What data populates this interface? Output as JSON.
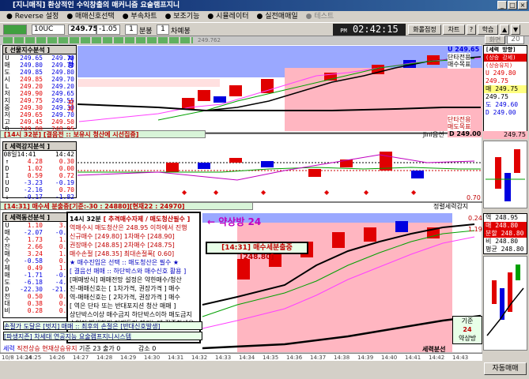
{
  "window": {
    "title": "[지니매직] 환상적인 수익창출의 매커니즘 요술램프지니"
  },
  "menu": [
    {
      "label": "Reverse 설정",
      "enabled": true
    },
    {
      "label": "매매신호선택",
      "enabled": true
    },
    {
      "label": "부속차트",
      "enabled": true
    },
    {
      "label": "보조기능",
      "enabled": true
    },
    {
      "label": "시뮬레이터",
      "enabled": true
    },
    {
      "label": "실전매매일",
      "enabled": true
    },
    {
      "label": "테스트",
      "enabled": false
    }
  ],
  "toolbar": {
    "code": "10UC",
    "price": "249.75",
    "change": "-1.05",
    "period_num": "1",
    "period_unit": "분봉",
    "count_num": "1",
    "count_unit": "차예봉",
    "clock_prefix": "PM",
    "clock": "02:42:15",
    "btn_rotate": "화롤점정",
    "btn_chart": "차트",
    "btn_study": "학습",
    "btn_screen": "화면",
    "screen_num": "20"
  },
  "subbar": {
    "value": "249.762"
  },
  "panel1": {
    "title": "[ 선물지수분석 ]",
    "rows": [
      {
        "l": "U",
        "a": "249.65",
        "b": "249.70"
      },
      {
        "l": "매",
        "a": "249.80",
        "b": "249.70"
      },
      {
        "l": "도",
        "a": "249.85",
        "b": "249.80"
      },
      {
        "l": "시",
        "a": "249.85",
        "b": "249.70"
      },
      {
        "l": "L",
        "a": "249.20",
        "b": "249.20"
      },
      {
        "l": "저",
        "a": "249.90",
        "b": "249.65"
      },
      {
        "l": "지",
        "a": "249.75",
        "b": "249.55"
      },
      {
        "l": "중",
        "a": "249.30",
        "b": "249.30"
      },
      {
        "l": "저",
        "a": "249.65",
        "b": "249.70"
      },
      {
        "l": "고",
        "a": "249.45",
        "b": "249.50"
      },
      {
        "l": "D",
        "a": "249.80",
        "b": "248.95"
      },
      {
        "l": "%",
        "a": "0.76",
        "b": "0.76"
      }
    ],
    "side1": "지지",
    "side2": "저항"
  },
  "panel2": {
    "title": "[ 세력강지분석 ]",
    "header_time": "08일14:41",
    "header_time2": "14:42",
    "rows": [
      {
        "l": "↑",
        "a": "4.28",
        "b": "0.30"
      },
      {
        "l": "D",
        "a": "1.02",
        "b": "0.00"
      },
      {
        "l": "I",
        "a": "0.59",
        "b": "0.72"
      },
      {
        "l": "U",
        "a": "-3.23",
        "b": "-0.19"
      },
      {
        "l": "D",
        "a": "-2.16",
        "b": "0.70"
      },
      {
        "l": "↓",
        "a": "-0.17",
        "b": "-1.82"
      }
    ]
  },
  "panel3": {
    "title": "[ 세력동선분석 ]",
    "rows": [
      {
        "l": "U",
        "a": "1.10",
        "b": "3.05"
      },
      {
        "l": "매",
        "a": "-2.07",
        "b": "-0.06"
      },
      {
        "l": "수",
        "a": "1.73",
        "b": "1.86"
      },
      {
        "l": "잔",
        "a": "2.66",
        "b": "0.48"
      },
      {
        "l": "매",
        "a": "3.24",
        "b": "1.21"
      },
      {
        "l": "수",
        "a": "-0.58",
        "b": "0.30"
      },
      {
        "l": "체",
        "a": "0.49",
        "b": "1.19"
      },
      {
        "l": "매",
        "a": "-1.71",
        "b": "-0.05"
      },
      {
        "l": "도",
        "a": "-6.18",
        "b": "-4.49"
      },
      {
        "l": "D",
        "a": "-22.30",
        "b": "-21.10"
      },
      {
        "l": "전",
        "a": "0.50",
        "b": "0.64"
      },
      {
        "l": "대",
        "a": "0.38",
        "b": "0.24"
      },
      {
        "l": "비",
        "a": "0.28",
        "b": "0.28"
      }
    ]
  },
  "info": {
    "bar1": "[14시 32분] [결음전 :: 보유시 청산에 시선집중]",
    "bar1_right": "Jini음선",
    "bar1_value": "D 249.00",
    "bar2": "[14:31] 매수세 분출중[기준:-30 : 24880][현재22 : 24970]",
    "bar2_right": "정렬세력감지",
    "bar2_value": "0.70",
    "bar3_right": "세력분선",
    "status_left": "세력",
    "status_mid": "직전상승",
    "status_now": "현재상승유지",
    "status_base": "기준",
    "status_base_val": "23",
    "status_count": "출가",
    "status_count_val": "0",
    "status_decr": "감소",
    "status_decr_val": "0",
    "auto_btn": "자동매매"
  },
  "right1": {
    "title": "[세력 방향]",
    "subtitle": "(상승 강세)",
    "subtitle2": "(상승유지)",
    "rows": [
      "249.80",
      "249.75",
      "249.75",
      "249.75",
      "249.60",
      "249.00"
    ],
    "labels": [
      "U",
      "",
      "매",
      "",
      "도",
      "D"
    ],
    "label_mark": "249.75"
  },
  "right3": {
    "rows": [
      {
        "l": "역",
        "v": "248.95"
      },
      {
        "l": "매",
        "v": "248.80"
      },
      {
        "l": "분할",
        "v": "248.80"
      },
      {
        "l": "비",
        "v": "248.80"
      },
      {
        "l": "평균",
        "v": "248.80"
      }
    ],
    "top_val": "0.24",
    "mid_val": "1.19"
  },
  "chart1_badges": {
    "u_val": "U 249.65",
    "lbl1": "단타전용",
    "lbl2": "매수목표",
    "lbl3": "단타전용",
    "lbl4": "매도목표"
  },
  "notes": {
    "head1": "14시 32분",
    "head2": "[ 추격매수자제 / 매도청산필수 ]",
    "lines": [
      "역매수시 매도청산은 248.95 이하에서 진행",
      "신규매수 [249.80]   1차매수 [248.90]",
      "권장매수 [248.85]   2차매수 [248.75]",
      "매수손절 [248.35]   최대손절폭[ 0.60]",
      "★ 매수진입은 선택  :: 매도청산은 필수 ★",
      "[ 결음선 매매 :: 하단박스와 매수신호 활용 ]",
      "[매매방식] 매매전망 설정은 약한매수/청산",
      "    진-매매신호는 [ 1차가격, 권장가격 ] 매수",
      "    역-매매신호는 [ 2차가격, 권장가격 ] 매수",
      "    [ 역은 단타 또는 반대포지션 청산 매매 ]",
      "  상단박스이상 매수금지  하단박스이하 매도금지",
      "  수익이 발생하면 언제든지 챙기는데 집중하세요"
    ],
    "bottom1": "손절가 도달은 [벗지] 매매 :: 최후의 손절은 [반대신호발생]",
    "bottom2": "[파생지존] 차세대 연공지능 요술램프지니시스템"
  },
  "callout": {
    "text": "[14:31] 매수세분출중[248.80]",
    "big": "← 약상방 24"
  },
  "sbox": {
    "l1": "기준",
    "l2": "24",
    "l3": "약상방"
  },
  "time_axis": [
    "10/8 14:24",
    "14:25",
    "14:26",
    "14:27",
    "14:28",
    "14:29",
    "14:30",
    "14:31",
    "14:32",
    "14:33",
    "14:34",
    "14:35",
    "14:36",
    "14:37",
    "14:38",
    "14:39",
    "14:40",
    "14:41",
    "14:42",
    "14:43"
  ],
  "colors": {
    "red": "#e00000",
    "blue": "#0000e0",
    "green": "#00a000",
    "pink": "#ffb6c1",
    "lightblue": "#9aa8ff"
  }
}
